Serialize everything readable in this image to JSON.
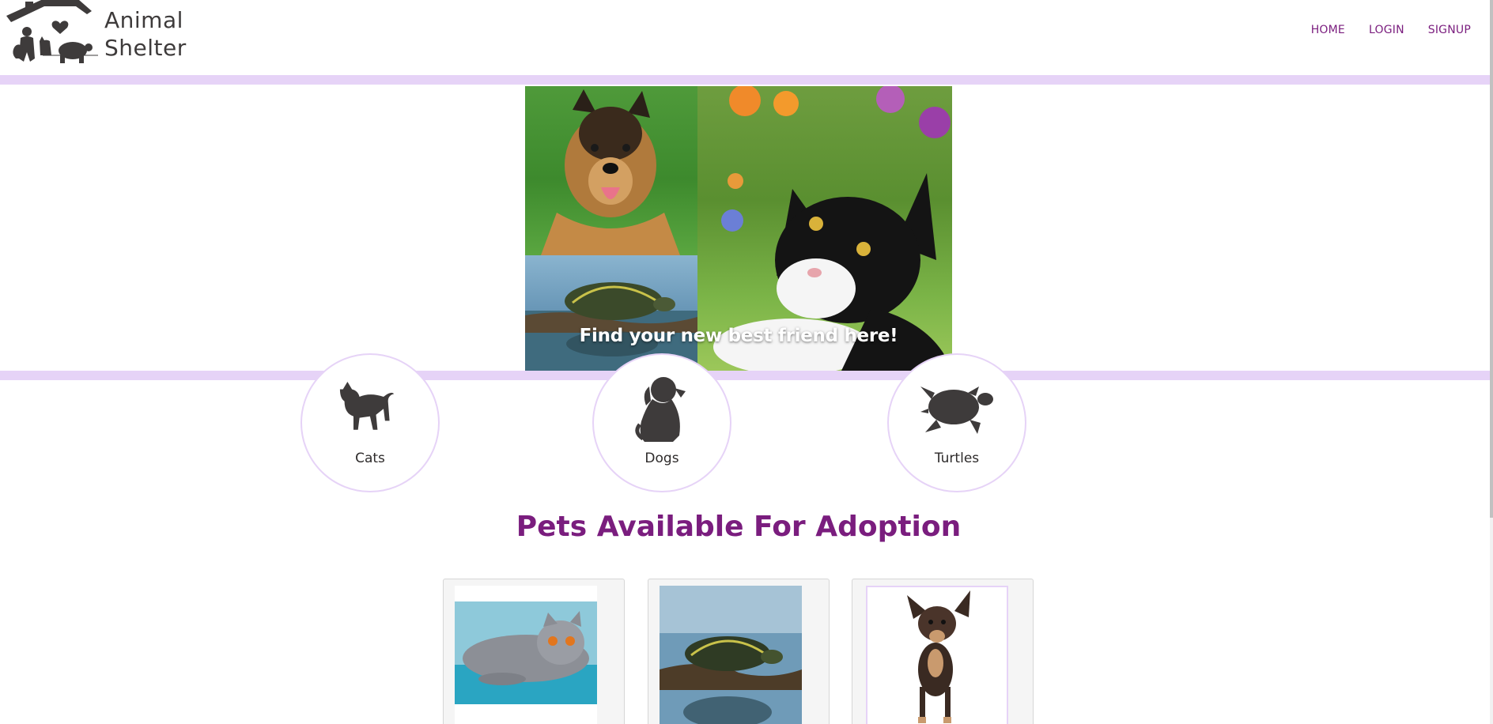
{
  "brand": {
    "line1": "Animal",
    "line2": "Shelter",
    "logo_icon": "house-with-pets-icon"
  },
  "nav": {
    "items": [
      {
        "label": "HOME"
      },
      {
        "label": "LOGIN"
      },
      {
        "label": "SIGNUP"
      }
    ]
  },
  "hero": {
    "caption": "Find your new best friend here!",
    "photos": [
      "german-shepherd-photo",
      "turtle-photo",
      "black-white-cat-photo"
    ]
  },
  "categories": [
    {
      "label": "Cats",
      "icon": "cat-silhouette-icon"
    },
    {
      "label": "Dogs",
      "icon": "dog-silhouette-icon"
    },
    {
      "label": "Turtles",
      "icon": "turtle-silhouette-icon"
    }
  ],
  "adoption": {
    "title": "Pets Available For Adoption",
    "pets": [
      {
        "photo": "grey-cat-photo"
      },
      {
        "photo": "turtle-photo"
      },
      {
        "photo": "chihuahua-photo"
      }
    ]
  },
  "colors": {
    "accent": "#7a1d7e",
    "stripe": "#e6d3f7",
    "silhouette": "#3e3b3b"
  }
}
